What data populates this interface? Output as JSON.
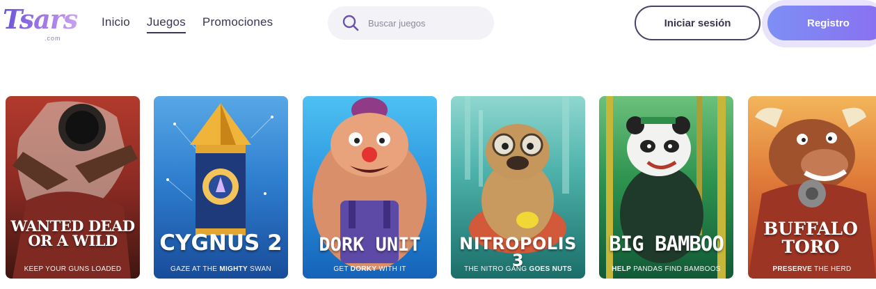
{
  "brand": {
    "logo_text": "Tsars",
    "logo_suffix": ".com"
  },
  "nav": {
    "items": [
      {
        "label": "Inicio",
        "active": false
      },
      {
        "label": "Juegos",
        "active": true
      },
      {
        "label": "Promociones",
        "active": false
      }
    ]
  },
  "search": {
    "placeholder": "Buscar juegos",
    "value": "",
    "icon": "search-icon"
  },
  "auth": {
    "login_label": "Iniciar sesión",
    "register_label": "Registro"
  },
  "colors": {
    "accent": "#7d8ff5",
    "accent2": "#8a6ff0",
    "text": "#3a3550"
  },
  "games": [
    {
      "title": "WANTED DEAD OR A WILD",
      "tagline": "KEEP YOUR GUNS LOADED"
    },
    {
      "title": "CYGNUS 2",
      "tagline": "GAZE AT THE MIGHTY SWAN"
    },
    {
      "title": "DORK UNIT",
      "tagline": "GET DORKY WITH IT"
    },
    {
      "title": "NITROPOLIS 3",
      "tagline": "THE NITRO GANG GOES NUTS"
    },
    {
      "title": "BIG BAMBOO",
      "tagline": "HELP PANDAS FIND BAMBOOS"
    },
    {
      "title": "BUFFALO TORO",
      "tagline": "PRESERVE THE HERD"
    }
  ]
}
